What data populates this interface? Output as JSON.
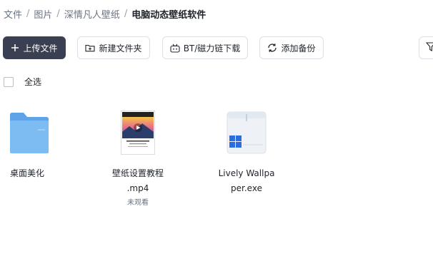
{
  "breadcrumb": {
    "items": [
      "文件",
      "图片",
      "深情凡人壁纸"
    ],
    "current": "电脑动态壁纸软件",
    "separator": "/"
  },
  "toolbar": {
    "upload_label": "上传文件",
    "new_folder_label": "新建文件夹",
    "bt_label": "BT/磁力链下载",
    "backup_label": "添加备份"
  },
  "select_all_label": "全选",
  "files": [
    {
      "name": "桌面美化",
      "type": "folder",
      "icon": "folder-icon"
    },
    {
      "name_line1": "壁纸设置教程",
      "name_line2": ".mp4",
      "status": "未观看",
      "type": "video",
      "icon": "video-thumbnail-icon"
    },
    {
      "name_line1": "Lively Wallpa",
      "name_line2": "per.exe",
      "type": "exe",
      "icon": "windows-installer-icon"
    }
  ],
  "colors": {
    "primary_button": "#3b3f52",
    "folder": "#6fb1ee",
    "exe_icon": "#2b6de0"
  }
}
